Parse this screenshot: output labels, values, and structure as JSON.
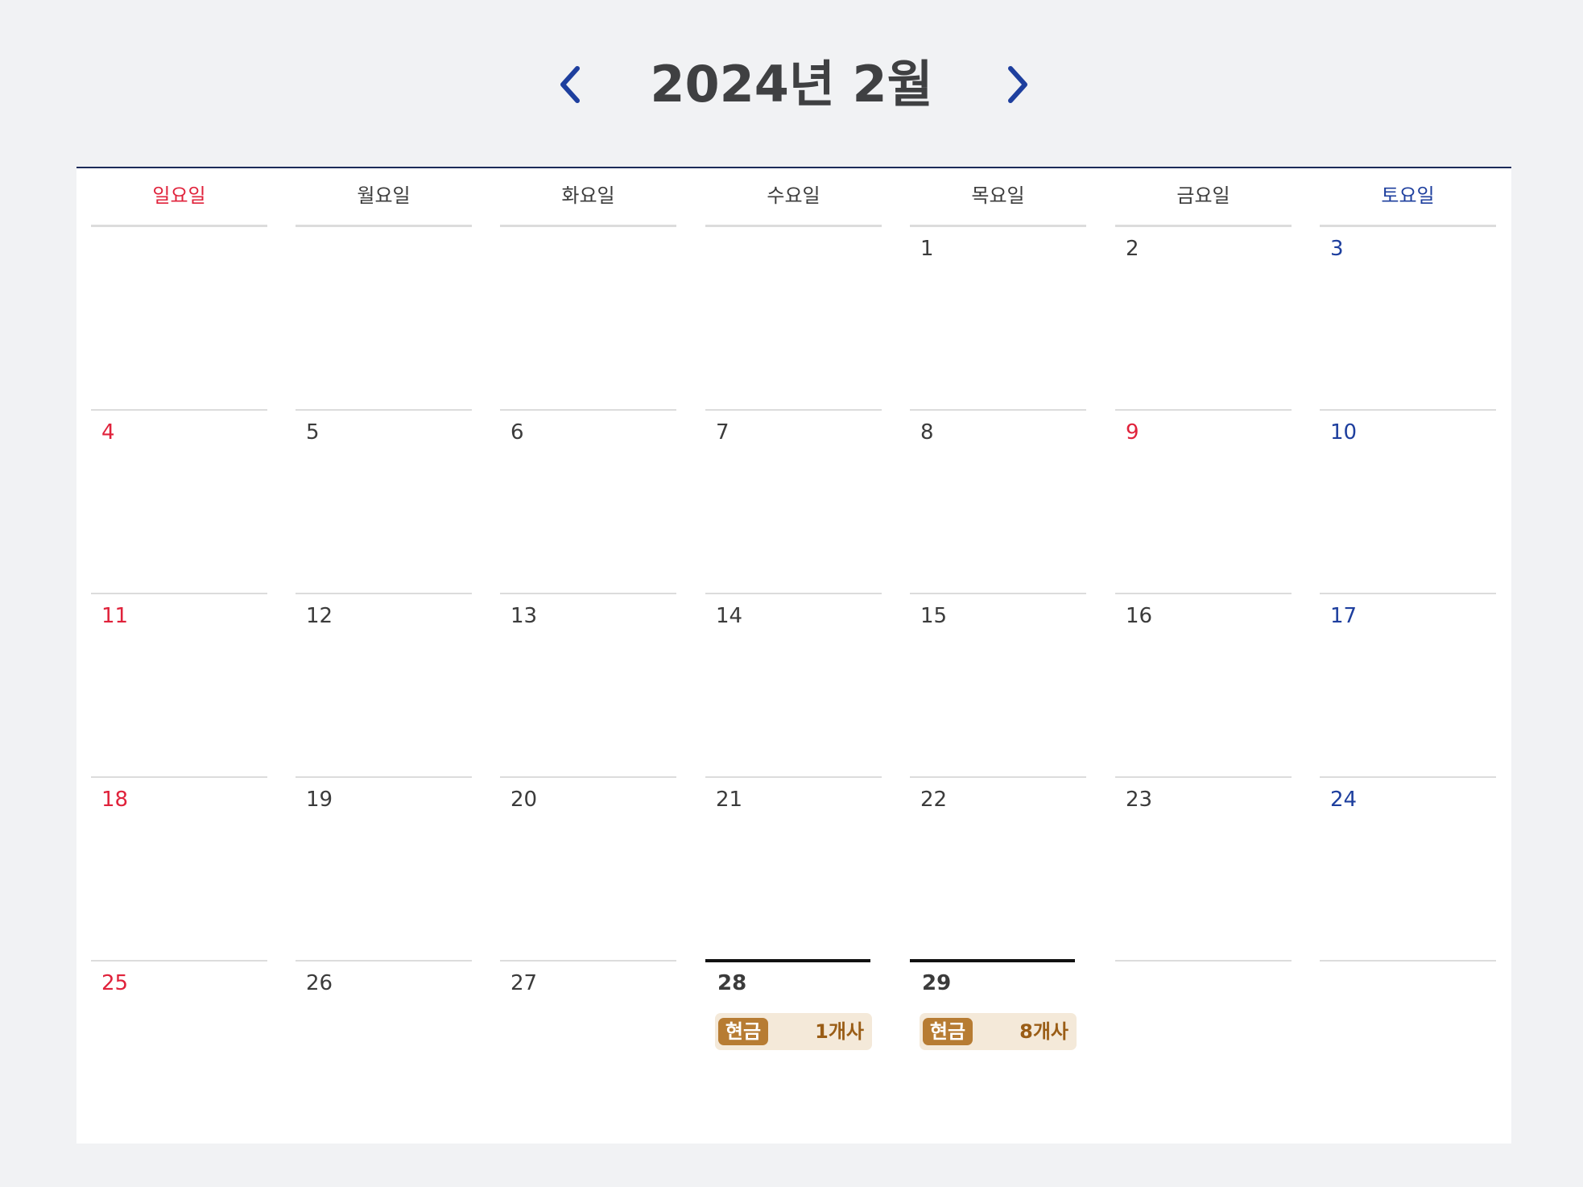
{
  "header": {
    "title": "2024년 2월",
    "prev_icon": "chevron-left-icon",
    "next_icon": "chevron-right-icon",
    "accent_color": "#1e3f9e"
  },
  "weekdays": [
    "일요일",
    "월요일",
    "화요일",
    "수요일",
    "목요일",
    "금요일",
    "토요일"
  ],
  "colors": {
    "sunday": "#e0223b",
    "saturday": "#1e3f9e",
    "default_text": "#3b3b3b",
    "event_tag_bg": "#b77c33",
    "event_bg": "#f4e9d9",
    "event_count": "#9a5d16"
  },
  "weeks": [
    [
      "",
      "",
      "",
      "",
      "1",
      "2",
      "3"
    ],
    [
      "4",
      "5",
      "6",
      "7",
      "8",
      "9",
      "10"
    ],
    [
      "11",
      "12",
      "13",
      "14",
      "15",
      "16",
      "17"
    ],
    [
      "18",
      "19",
      "20",
      "21",
      "22",
      "23",
      "24"
    ],
    [
      "25",
      "26",
      "27",
      "28",
      "29",
      "",
      ""
    ]
  ],
  "holidays": [
    "9"
  ],
  "events": {
    "28": {
      "tag": "현금",
      "count": "1개사"
    },
    "29": {
      "tag": "현금",
      "count": "8개사"
    }
  }
}
